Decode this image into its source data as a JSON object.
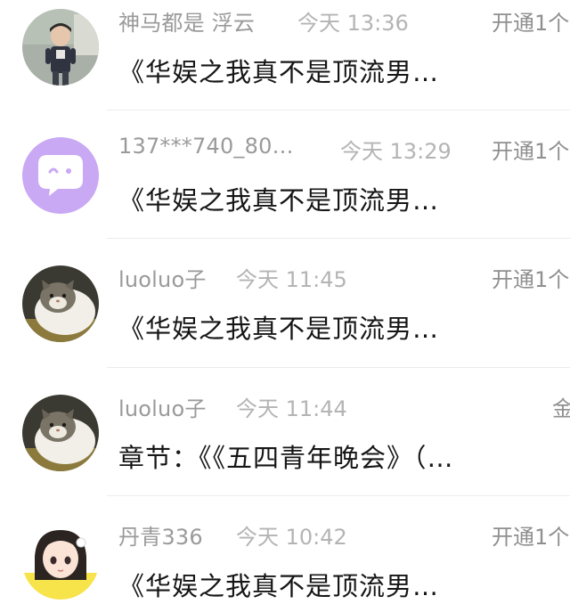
{
  "items": [
    {
      "name": "神马都是 浮云",
      "time": "今天 13:36",
      "action": "开通1个",
      "message": "《华娱之我真不是顶流男…",
      "avatar_icon": "boy-photo-avatar-icon"
    },
    {
      "name": "137***740_80…",
      "time": "今天 13:29",
      "action": "开通1个",
      "message": "《华娱之我真不是顶流男…",
      "avatar_icon": "chat-bubble-default-avatar-icon"
    },
    {
      "name": "luoluo子",
      "time": "今天 11:45",
      "action": "开通1个",
      "message": "《华娱之我真不是顶流男…",
      "avatar_icon": "cat-photo-avatar-icon"
    },
    {
      "name": "luoluo子",
      "time": "今天 11:44",
      "action": "金",
      "message": "章节：《《五四青年晚会》（…",
      "avatar_icon": "cat-photo-avatar-icon"
    },
    {
      "name": "丹青336",
      "time": "今天 10:42",
      "action": "开通1个",
      "message": "《华娱之我真不是顶流男…",
      "avatar_icon": "anime-girl-avatar-icon"
    }
  ],
  "colors": {
    "default_avatar_bg": "#c9a8f4",
    "name_text": "#9a9a9a",
    "time_text": "#b4b4b4",
    "message_text": "#161616"
  }
}
